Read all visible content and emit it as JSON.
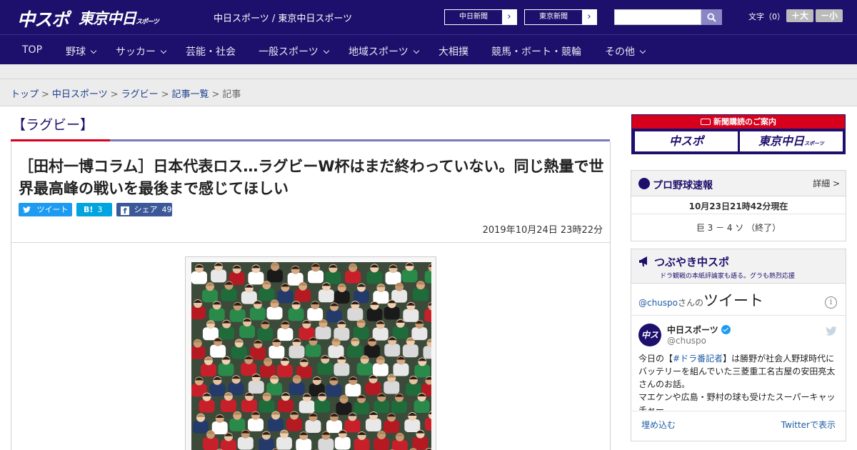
{
  "header": {
    "logo_chu": "中スポ",
    "logo_tokyo": "東京中日",
    "logo_tokyo_small": "スポーツ",
    "site_links": "中日スポーツ / 東京中日スポーツ",
    "newspaper_buttons": [
      "中日新聞",
      "東京新聞"
    ],
    "font_size_label": "文字（0）",
    "font_larger": "＋大",
    "font_smaller": "－小",
    "search_placeholder": ""
  },
  "nav": {
    "items": [
      "TOP",
      "野球",
      "サッカー",
      "芸能・社会",
      "一般スポーツ",
      "地域スポーツ",
      "大相撲",
      "競馬・ボート・競輪",
      "その他"
    ],
    "has_dropdown": [
      false,
      true,
      true,
      false,
      true,
      true,
      false,
      false,
      true
    ]
  },
  "breadcrumb": {
    "items": [
      "トップ",
      "中日スポーツ",
      "ラグビー",
      "記事一覧"
    ],
    "current": "記事",
    "separator": ">"
  },
  "category": {
    "title": "【ラグビー】"
  },
  "article": {
    "title": "［田村一博コラム］日本代表ロス…ラグビーW杯はまだ終わっていない。同じ熱量で世界最高峰の戦いを最後まで感じてほしい",
    "date": "2019年10月24日 23時22分",
    "share": {
      "tweet_label": "ツイート",
      "hatena_label": "B!",
      "hatena_count": "3",
      "facebook_label": "シェア",
      "facebook_count": "49"
    }
  },
  "sidebar": {
    "subscription": {
      "banner_text": "新聞購読のご案内",
      "buttons": [
        "中スポ",
        "東京中日"
      ],
      "button2_small": "スポーツ"
    },
    "baseball": {
      "title": "プロ野球速報",
      "detail_link": "詳細 >",
      "updated": "10月23日21時42分現在",
      "score_line": "巨 3 － 4 ソ （終了）"
    },
    "twitter": {
      "title": "つぶやき中スポ",
      "subtitle": "ドラ観戦の本紙評論家も語る。グラも熱烈応援",
      "handle_link": "@chuspo",
      "handle_suffix": "さんの",
      "heading_big": "ツイート",
      "user_name": "中日スポーツ",
      "user_handle": "@chuspo",
      "avatar_text": "中スポ",
      "tweet_line1_prefix": "今日の【",
      "tweet_hashtag": "#ドラ番記者",
      "tweet_line1_rest": "】は勝野が社会人野球時代にバッテリーを組んでいた三菱重工名古屋の安田亮太さんのお話。",
      "tweet_line2": "マエケンや広島・野村の球も受けたスーパーキャッチャー",
      "embed_label": "埋め込む",
      "view_on_twitter": "Twitterで表示"
    }
  },
  "colors": {
    "brand_navy": "#1d0f6c",
    "accent_red": "#d6001c",
    "twitter_blue": "#1d9bf0",
    "hatena_blue": "#00a4de",
    "facebook_blue": "#3b5998"
  }
}
